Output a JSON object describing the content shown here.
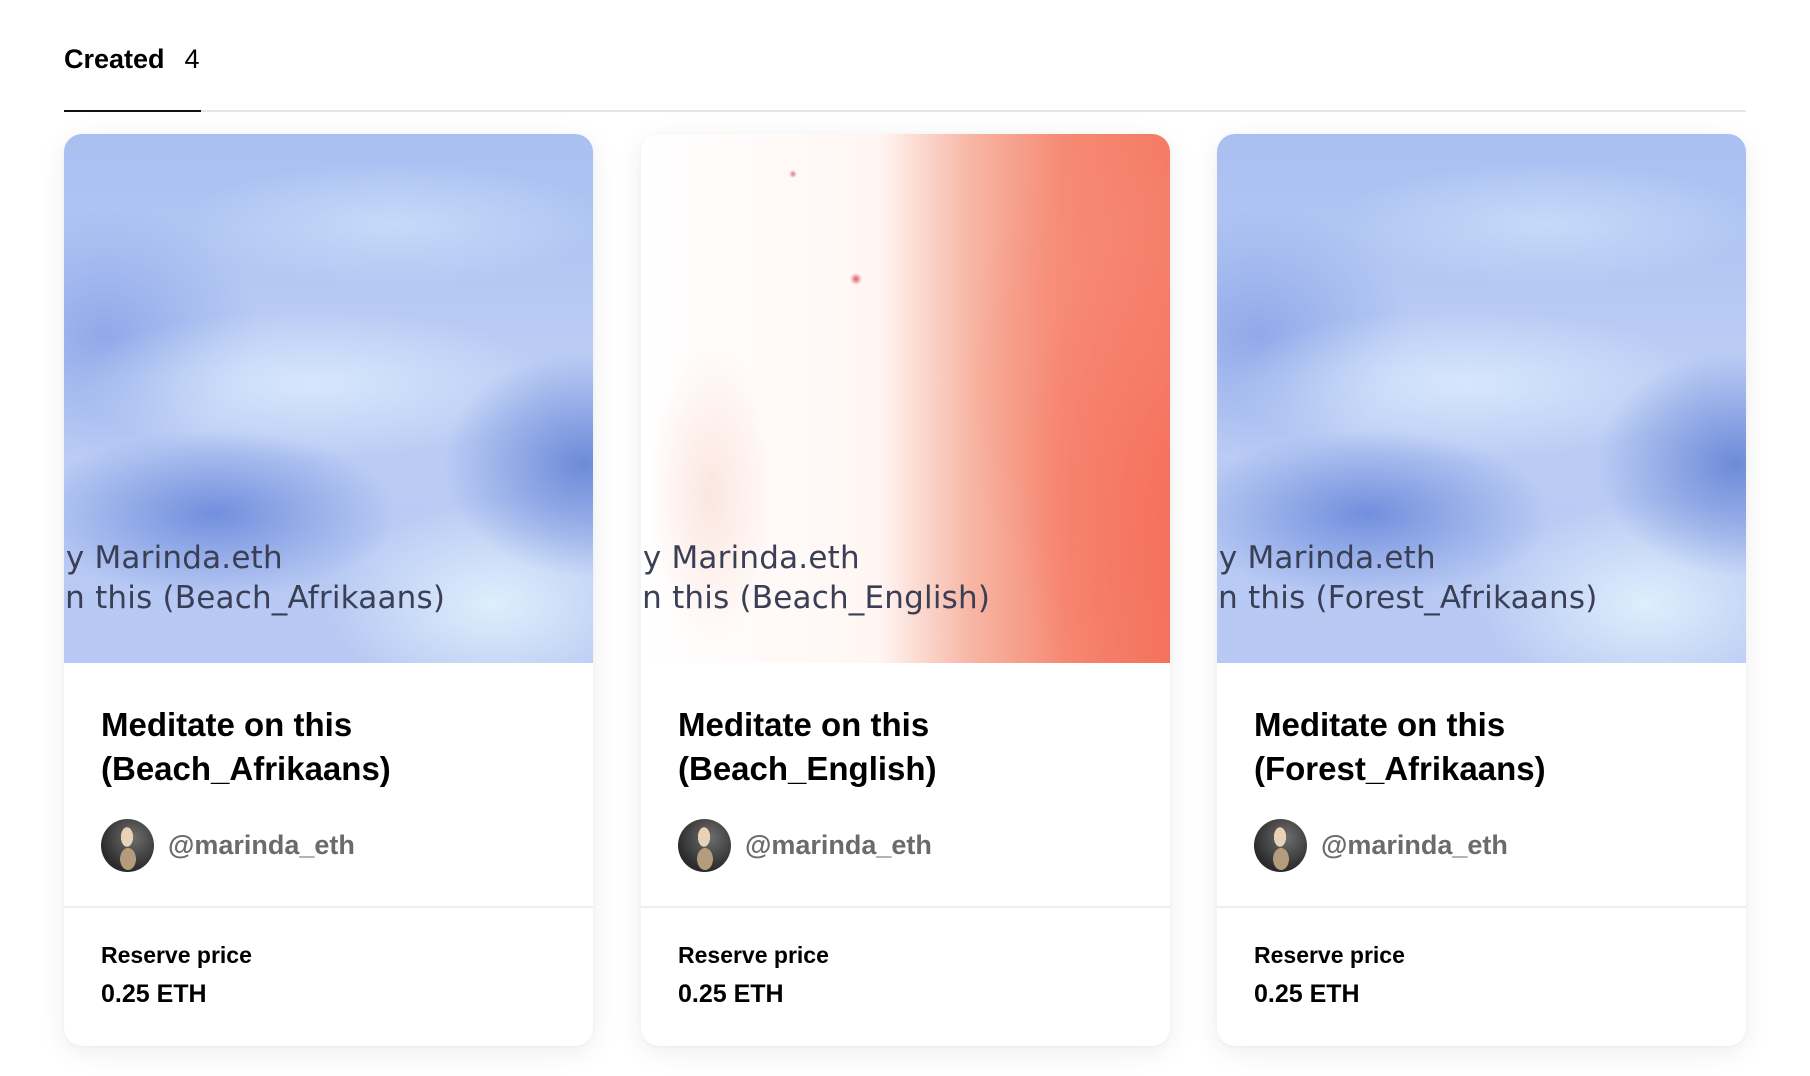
{
  "tabs": [
    {
      "label": "Created",
      "count": "4"
    }
  ],
  "cards": [
    {
      "thumbnail_text": [
        " by Marinda.eth",
        "on this (Beach_Afrikaans)"
      ],
      "title_line1": "Meditate on this",
      "title_line2": "(Beach_Afrikaans)",
      "creator": "@marinda_eth",
      "price_label": "Reserve price",
      "price": "0.25 ETH"
    },
    {
      "thumbnail_text": [
        " by Marinda.eth",
        "on this (Beach_English)"
      ],
      "title_line1": "Meditate on this",
      "title_line2": "(Beach_English)",
      "creator": "@marinda_eth",
      "price_label": "Reserve price",
      "price": "0.25 ETH"
    },
    {
      "thumbnail_text": [
        " by Marinda.eth",
        "on this (Forest_Afrikaans)"
      ],
      "title_line1": "Meditate on this",
      "title_line2": "(Forest_Afrikaans)",
      "creator": "@marinda_eth",
      "price_label": "Reserve price",
      "price": "0.25 ETH"
    }
  ]
}
